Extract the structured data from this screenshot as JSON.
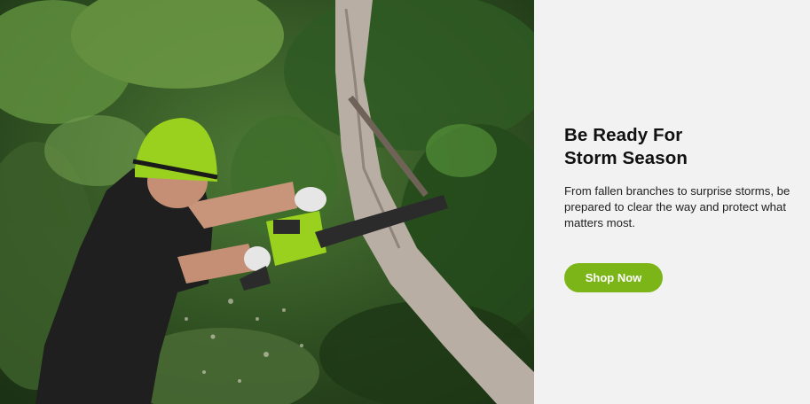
{
  "banner": {
    "headline_line1": "Be Ready For",
    "headline_line2": "Storm Season",
    "body": "From fallen branches to surprise storms, be prepared to clear the way and protect what matters most.",
    "cta_label": "Shop Now"
  },
  "colors": {
    "accent": "#7cb518",
    "panel_background": "#f2f2f2",
    "headline": "#111111"
  },
  "hero_image": {
    "icon": "chainsaw-worker-photo"
  }
}
